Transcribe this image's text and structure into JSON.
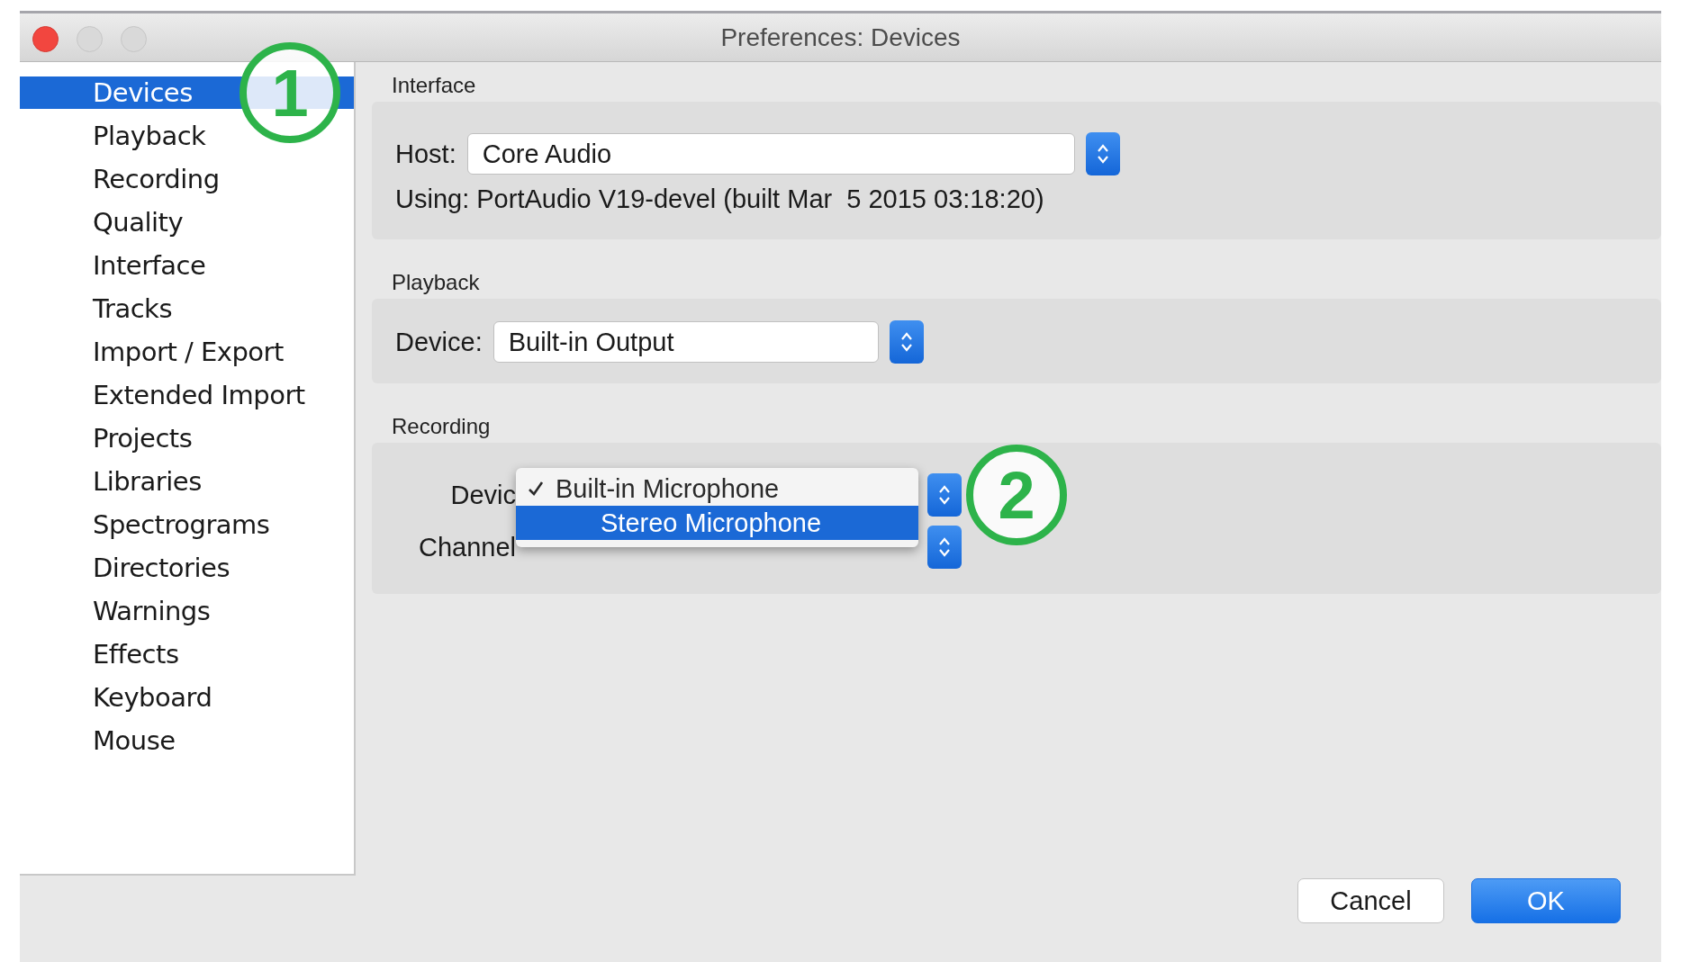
{
  "window": {
    "title": "Preferences: Devices"
  },
  "sidebar": {
    "items": [
      {
        "label": "Devices",
        "selected": true
      },
      {
        "label": "Playback",
        "selected": false
      },
      {
        "label": "Recording",
        "selected": false
      },
      {
        "label": "Quality",
        "selected": false
      },
      {
        "label": "Interface",
        "selected": false
      },
      {
        "label": "Tracks",
        "selected": false
      },
      {
        "label": "Import / Export",
        "selected": false
      },
      {
        "label": "Extended Import",
        "selected": false
      },
      {
        "label": "Projects",
        "selected": false
      },
      {
        "label": "Libraries",
        "selected": false
      },
      {
        "label": "Spectrograms",
        "selected": false
      },
      {
        "label": "Directories",
        "selected": false
      },
      {
        "label": "Warnings",
        "selected": false
      },
      {
        "label": "Effects",
        "selected": false
      },
      {
        "label": "Keyboard",
        "selected": false
      },
      {
        "label": "Mouse",
        "selected": false
      }
    ]
  },
  "interface": {
    "heading": "Interface",
    "host_label": "Host:",
    "host_value": "Core Audio",
    "using_text": "Using: PortAudio V19-devel (built Mar  5 2015 03:18:20)"
  },
  "playback": {
    "heading": "Playback",
    "device_label": "Device:",
    "device_value": "Built-in Output"
  },
  "recording": {
    "heading": "Recording",
    "device_label": "Devic",
    "channels_label": "Channel",
    "device_menu": [
      {
        "label": "Built-in Microphone",
        "checked": true,
        "selected": false
      },
      {
        "label": "Stereo Microphone",
        "checked": false,
        "selected": true
      }
    ]
  },
  "buttons": [
    {
      "label": "Cancel",
      "kind": "default"
    },
    {
      "label": "OK",
      "kind": "primary"
    }
  ],
  "annotations": [
    {
      "label": "1"
    },
    {
      "label": "2"
    }
  ]
}
